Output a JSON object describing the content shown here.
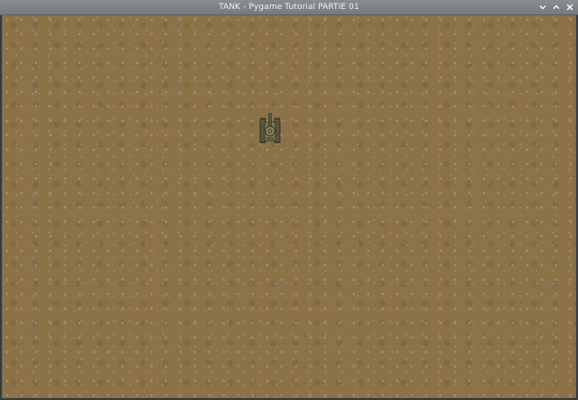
{
  "window": {
    "title": "TANK - Pygame Tutorial PARTIE 01",
    "controls": [
      {
        "name": "minimize",
        "icon": "chevron-down-icon"
      },
      {
        "name": "maximize",
        "icon": "chevron-up-icon"
      },
      {
        "name": "close",
        "icon": "close-icon"
      }
    ]
  },
  "game": {
    "background": "sand-terrain-tile",
    "player": {
      "sprite": "tank-icon",
      "facing": "up"
    }
  },
  "colors": {
    "terrain": "#8c7246",
    "titlebar": "#80848a",
    "tank_body": "#6b6a4a"
  }
}
